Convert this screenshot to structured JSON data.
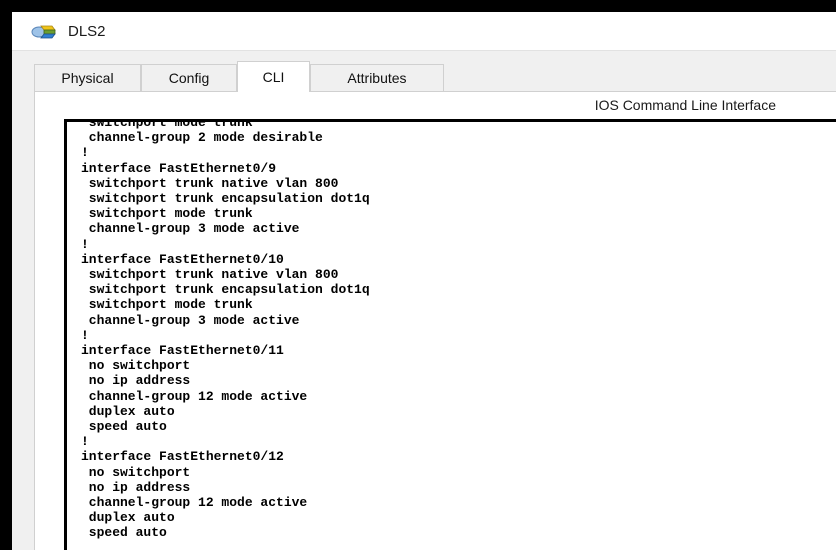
{
  "window": {
    "title": "DLS2"
  },
  "tabs": [
    {
      "label": "Physical",
      "active": false
    },
    {
      "label": "Config",
      "active": false
    },
    {
      "label": "CLI",
      "active": true
    },
    {
      "label": "Attributes",
      "active": false
    }
  ],
  "panel": {
    "heading": "IOS Command Line Interface"
  },
  "cli": {
    "lines": [
      " switchport mode trunk",
      " channel-group 2 mode desirable",
      "!",
      "interface FastEthernet0/9",
      " switchport trunk native vlan 800",
      " switchport trunk encapsulation dot1q",
      " switchport mode trunk",
      " channel-group 3 mode active",
      "!",
      "interface FastEthernet0/10",
      " switchport trunk native vlan 800",
      " switchport trunk encapsulation dot1q",
      " switchport mode trunk",
      " channel-group 3 mode active",
      "!",
      "interface FastEthernet0/11",
      " no switchport",
      " no ip address",
      " channel-group 12 mode active",
      " duplex auto",
      " speed auto",
      "!",
      "interface FastEthernet0/12",
      " no switchport",
      " no ip address",
      " channel-group 12 mode active",
      " duplex auto",
      " speed auto"
    ]
  },
  "icons": {
    "app": "packet-tracer-switch-icon"
  }
}
